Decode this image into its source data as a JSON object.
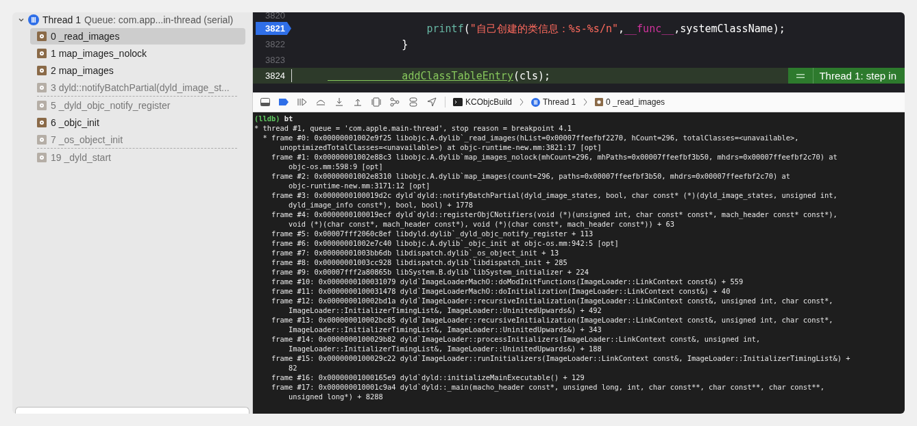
{
  "thread": {
    "title": "Thread 1",
    "queue": "Queue: com.app...in-thread (serial)",
    "expanded": true
  },
  "frames": [
    {
      "label": "0 _read_images",
      "selected": true,
      "dimmed": false,
      "separator_after": false
    },
    {
      "label": "1 map_images_nolock",
      "selected": false,
      "dimmed": false,
      "separator_after": false
    },
    {
      "label": "2 map_images",
      "selected": false,
      "dimmed": false,
      "separator_after": false
    },
    {
      "label": "3 dyld::notifyBatchPartial(dyld_image_st...",
      "selected": false,
      "dimmed": true,
      "separator_after": true
    },
    {
      "label": "5 _dyld_objc_notify_register",
      "selected": false,
      "dimmed": true,
      "separator_after": false
    },
    {
      "label": "6 _objc_init",
      "selected": false,
      "dimmed": false,
      "separator_after": false
    },
    {
      "label": "7 _os_object_init",
      "selected": false,
      "dimmed": true,
      "separator_after": true
    },
    {
      "label": "19 _dyld_start",
      "selected": false,
      "dimmed": true,
      "separator_after": false
    }
  ],
  "code": [
    {
      "number": "3820",
      "breakpoint": false,
      "current": false
    },
    {
      "number": "3821",
      "breakpoint": true,
      "current": false,
      "tokens": [
        {
          "kind": "func",
          "text": "                printf"
        },
        {
          "kind": "plain",
          "text": "("
        },
        {
          "kind": "string",
          "text": "\"自己创建的类信息：%s-%s/n\""
        },
        {
          "kind": "plain",
          "text": ","
        },
        {
          "kind": "macro",
          "text": "__func__"
        },
        {
          "kind": "plain",
          "text": ",systemClassName);"
        }
      ]
    },
    {
      "number": "3822",
      "breakpoint": false,
      "current": false,
      "tokens": [
        {
          "kind": "plain",
          "text": "            }"
        }
      ]
    },
    {
      "number": "3823",
      "breakpoint": false,
      "current": false
    },
    {
      "number": "3824",
      "breakpoint": false,
      "current": true,
      "tokens": [
        {
          "kind": "call",
          "text": "            addClassTableEntry"
        },
        {
          "kind": "plain",
          "text": "(cls);"
        }
      ]
    }
  ],
  "step_label": "Thread 1: step in",
  "breadcrumb": [
    {
      "kind": "target",
      "text": "KCObjcBuild"
    },
    {
      "kind": "thread",
      "text": "Thread 1"
    },
    {
      "kind": "frame",
      "text": "0 _read_images"
    }
  ],
  "console": {
    "prompt": "(lldb)",
    "command": "bt",
    "lines": [
      "* thread #1, queue = 'com.apple.main-thread', stop reason = breakpoint 4.1",
      "  * frame #0: 0x00000001002e9f25 libobjc.A.dylib`_read_images(hList=0x00007ffeefbf2270, hCount=296, totalClasses=<unavailable>,",
      "      unoptimizedTotalClasses=<unavailable>) at objc-runtime-new.mm:3821:17 [opt]",
      "    frame #1: 0x00000001002e88c3 libobjc.A.dylib`map_images_nolock(mhCount=296, mhPaths=0x00007ffeefbf3b50, mhdrs=0x00007ffeefbf2c70) at",
      "        objc-os.mm:598:9 [opt]",
      "    frame #2: 0x00000001002e8310 libobjc.A.dylib`map_images(count=296, paths=0x00007ffeefbf3b50, mhdrs=0x00007ffeefbf2c70) at",
      "        objc-runtime-new.mm:3171:12 [opt]",
      "    frame #3: 0x0000000100019d2c dyld`dyld::notifyBatchPartial(dyld_image_states, bool, char const* (*)(dyld_image_states, unsigned int,",
      "        dyld_image_info const*), bool, bool) + 1778",
      "    frame #4: 0x0000000100019ecf dyld`dyld::registerObjCNotifiers(void (*)(unsigned int, char const* const*, mach_header const* const*),",
      "        void (*)(char const*, mach_header const*), void (*)(char const*, mach_header const*)) + 63",
      "    frame #5: 0x00007fff2060c8ef libdyld.dylib`_dyld_objc_notify_register + 113",
      "    frame #6: 0x00000001002e7c40 libobjc.A.dylib`_objc_init at objc-os.mm:942:5 [opt]",
      "    frame #7: 0x00000001003bb6db libdispatch.dylib`_os_object_init + 13",
      "    frame #8: 0x00000001003cc928 libdispatch.dylib`libdispatch_init + 285",
      "    frame #9: 0x00007fff2a80865b libSystem.B.dylib`libSystem_initializer + 224",
      "    frame #10: 0x0000000100031079 dyld`ImageLoaderMachO::doModInitFunctions(ImageLoader::LinkContext const&) + 559",
      "    frame #11: 0x0000000100031478 dyld`ImageLoaderMachO::doInitialization(ImageLoader::LinkContext const&) + 40",
      "    frame #12: 0x000000010002bd1a dyld`ImageLoader::recursiveInitialization(ImageLoader::LinkContext const&, unsigned int, char const*,",
      "        ImageLoader::InitializerTimingList&, ImageLoader::UninitedUpwards&) + 492",
      "    frame #13: 0x000000010002bc85 dyld`ImageLoader::recursiveInitialization(ImageLoader::LinkContext const&, unsigned int, char const*,",
      "        ImageLoader::InitializerTimingList&, ImageLoader::UninitedUpwards&) + 343",
      "    frame #14: 0x0000000100029b82 dyld`ImageLoader::processInitializers(ImageLoader::LinkContext const&, unsigned int,",
      "        ImageLoader::InitializerTimingList&, ImageLoader::UninitedUpwards&) + 188",
      "    frame #15: 0x0000000100029c22 dyld`ImageLoader::runInitializers(ImageLoader::LinkContext const&, ImageLoader::InitializerTimingList&) +",
      "        82",
      "    frame #16: 0x00000001000165e9 dyld`dyld::initializeMainExecutable() + 129",
      "    frame #17: 0x000000010001c9a4 dyld`dyld::_main(macho_header const*, unsigned long, int, char const**, char const**, char const**,",
      "        unsigned long*) + 8288"
    ]
  }
}
